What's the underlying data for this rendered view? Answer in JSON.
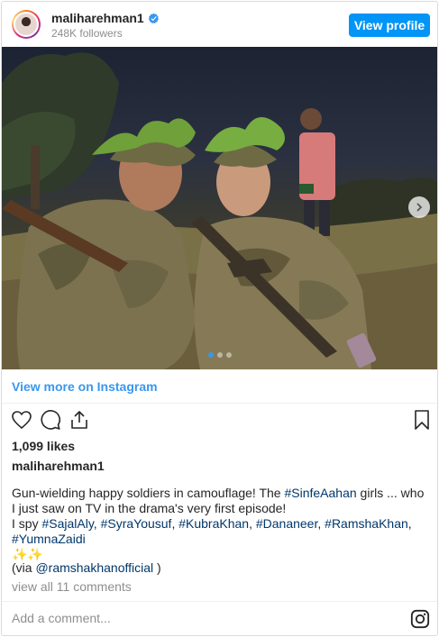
{
  "header": {
    "username": "maliharehman1",
    "followers": "248K followers",
    "view_profile_label": "View profile"
  },
  "media": {
    "carousel_total": 3,
    "carousel_active_index": 0
  },
  "view_more_label": "View more on Instagram",
  "likes": "1,099 likes",
  "caption": {
    "username": "maliharehman1",
    "line1_pre": "Gun-wielding happy soldiers in camouflage! The ",
    "line1_tag": "#SinfeAahan",
    "line1_post": " girls ... who I just saw on TV in the drama's very first episode!",
    "spy_pre": "I spy ",
    "tags": [
      "#SajalAly",
      "#SyraYousuf",
      "#KubraKhan",
      "#Dananeer",
      "#RamshaKhan",
      "#YumnaZaidi"
    ],
    "emoji": "✨✨",
    "via_pre": "(via ",
    "via_tag": "@ramshakhanofficial",
    "via_post": " )"
  },
  "comments_label": "view all 11 comments",
  "comment_placeholder": "Add a comment...",
  "colors": {
    "accent": "#0095f6",
    "link": "#3897f0",
    "hashtag": "#00376b",
    "muted": "#8e8e8e"
  },
  "icons": {
    "like": "heart-icon",
    "comment": "comment-icon",
    "share": "share-icon",
    "save": "bookmark-icon",
    "instagram": "instagram-logo-icon",
    "verified": "verified-badge-icon",
    "next": "chevron-right-icon"
  }
}
